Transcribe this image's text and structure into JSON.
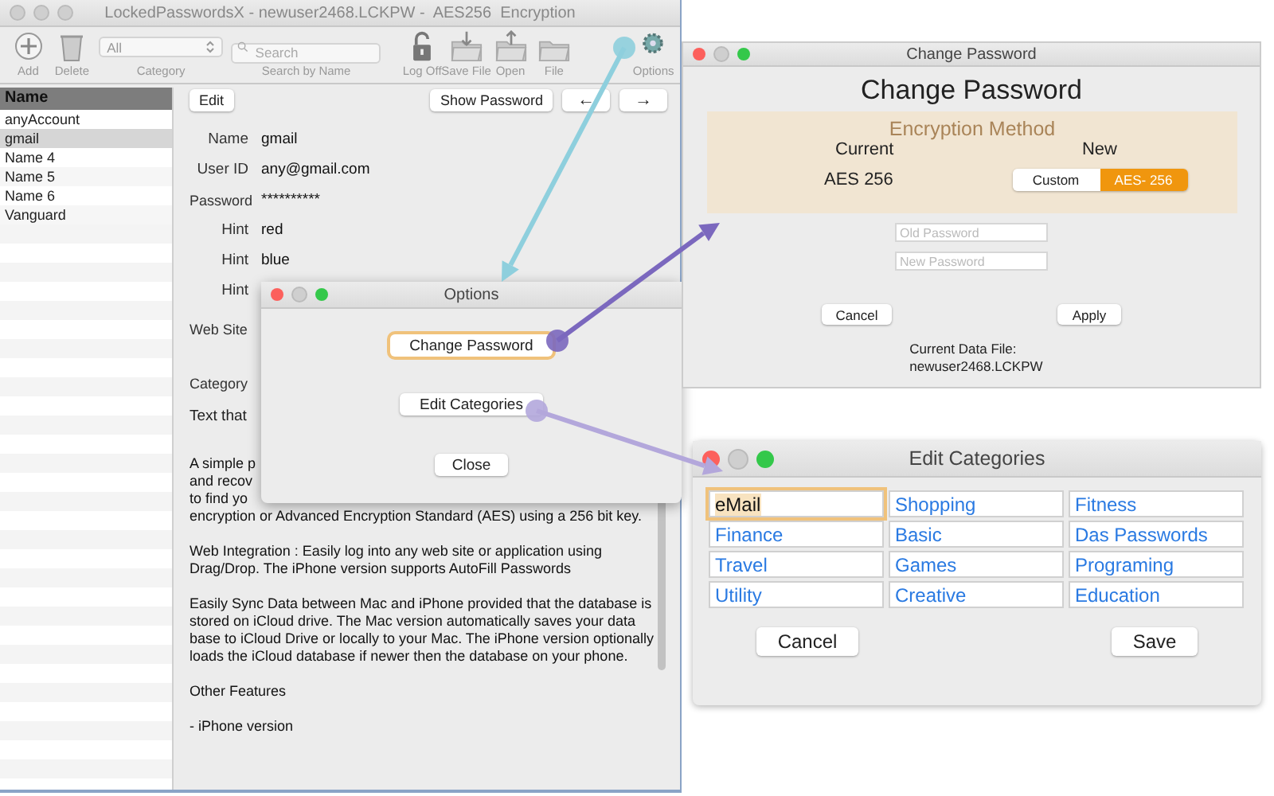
{
  "main_window": {
    "title": "LockedPasswordsX - newuser2468.LCKPW -  AES256  Encryption",
    "toolbar_left": [
      {
        "label": "Add"
      },
      {
        "label": "Delete"
      }
    ],
    "category": {
      "value": "All",
      "label": "Category"
    },
    "search": {
      "placeholder": "Search",
      "label": "Search by Name"
    },
    "toolbar_right": [
      {
        "label": "Log Off"
      },
      {
        "label": "Save File"
      },
      {
        "label": "Open"
      },
      {
        "label": "File"
      },
      {
        "label": "Options"
      }
    ],
    "sidebar": {
      "header": "Name",
      "items": [
        {
          "label": "anyAccount",
          "selected": false
        },
        {
          "label": "gmail",
          "selected": true
        },
        {
          "label": "Name 4",
          "selected": false
        },
        {
          "label": "Name 5",
          "selected": false
        },
        {
          "label": "Name 6",
          "selected": false
        },
        {
          "label": "Vanguard",
          "selected": false
        }
      ]
    },
    "detail": {
      "edit_button": "Edit",
      "show_password_button": "Show Password",
      "back_button": "←",
      "forward_button": "→",
      "fields": [
        {
          "label": "Name",
          "value": "gmail"
        },
        {
          "label": "User ID",
          "value": "any@gmail.com"
        },
        {
          "label": "Password",
          "value": "**********"
        },
        {
          "label": "Hint",
          "value": "red"
        },
        {
          "label": "Hint",
          "value": "blue"
        },
        {
          "label": "Hint"
        }
      ],
      "web_site_label": "Web Site",
      "category_label": "Category",
      "text_fragment": "Text that",
      "covered_lines": [
        "A simple p",
        "and recov",
        "to find yo"
      ],
      "paragraphs": [
        "encryption or Advanced Encryption Standard (AES) using a 256 bit key.",
        "Web Integration : Easily log into any web site or application using Drag/Drop. The iPhone version supports AutoFill Passwords",
        "Easily Sync Data between Mac and iPhone provided that the database is stored on iCloud drive. The Mac version automatically saves your data base to iCloud Drive or locally to your Mac. The iPhone version optionally loads the iCloud database if newer then the database on your phone.",
        "Other Features",
        "-  iPhone version"
      ]
    }
  },
  "options_dialog": {
    "title": "Options",
    "buttons": [
      {
        "label": "Change Password",
        "focused": true
      },
      {
        "label": "Edit Categories",
        "focused": false
      },
      {
        "label": "Close",
        "focused": false
      }
    ]
  },
  "change_password_window": {
    "title": "Change Password",
    "heading": "Change Password",
    "panel_title": "Encryption Method",
    "current_label": "Current",
    "new_label": "New",
    "current_value": "AES 256",
    "methods": [
      {
        "label": "Custom",
        "selected": false
      },
      {
        "label": "AES- 256",
        "selected": true
      }
    ],
    "old_password": {
      "placeholder": "Old Password"
    },
    "new_password": {
      "placeholder": "New Password"
    },
    "cancel_button": "Cancel",
    "apply_button": "Apply",
    "data_file_label": "Current Data File:",
    "data_file": "newuser2468.LCKPW"
  },
  "edit_categories_window": {
    "title": "Edit Categories",
    "categories": [
      {
        "label": "eMail",
        "selected": true
      },
      {
        "label": "Shopping",
        "selected": false
      },
      {
        "label": "Fitness",
        "selected": false
      },
      {
        "label": "Finance",
        "selected": false
      },
      {
        "label": "Basic",
        "selected": false
      },
      {
        "label": "Das Passwords",
        "selected": false
      },
      {
        "label": "Travel",
        "selected": false
      },
      {
        "label": "Games",
        "selected": false
      },
      {
        "label": "Programing",
        "selected": false
      },
      {
        "label": "Utility",
        "selected": false
      },
      {
        "label": "Creative",
        "selected": false
      },
      {
        "label": "Education",
        "selected": false
      }
    ],
    "cancel_button": "Cancel",
    "save_button": "Save"
  }
}
